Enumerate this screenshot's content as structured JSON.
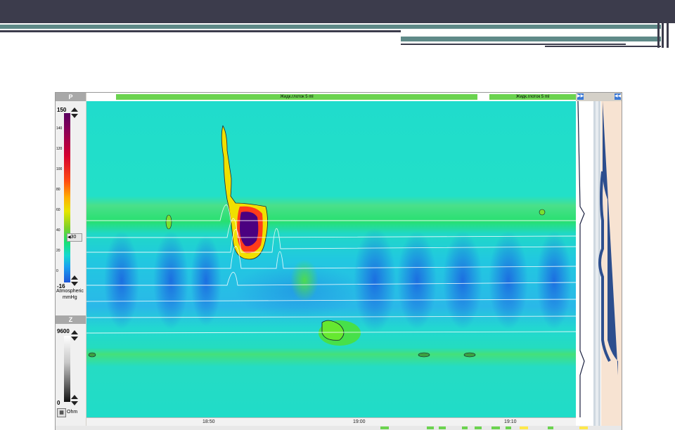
{
  "pressure_panel": {
    "header": "P",
    "max": "150",
    "min": "-16",
    "ticks": [
      "140",
      "120",
      "100",
      "80",
      "60",
      "40",
      "20",
      "0"
    ],
    "threshold_value": "30",
    "unit_line1": "Atmospheric",
    "unit_line2": "mmHg"
  },
  "impedance_panel": {
    "header": "Z",
    "max": "9600",
    "min": "0",
    "unit": "Ohm"
  },
  "events": [
    {
      "label": "Жидк.глоток 5 ml"
    },
    {
      "label": "Жидк.глоток 5 ml"
    }
  ],
  "time_axis": {
    "labels": [
      "18:50",
      "19:00",
      "19:10"
    ]
  },
  "colors": {
    "background_cyan": "#19e6d2",
    "event_green": "#6bd34f",
    "peak_purple": "#4b007a",
    "peak_red": "#e0102a",
    "accent_blue": "#3a78d6"
  }
}
